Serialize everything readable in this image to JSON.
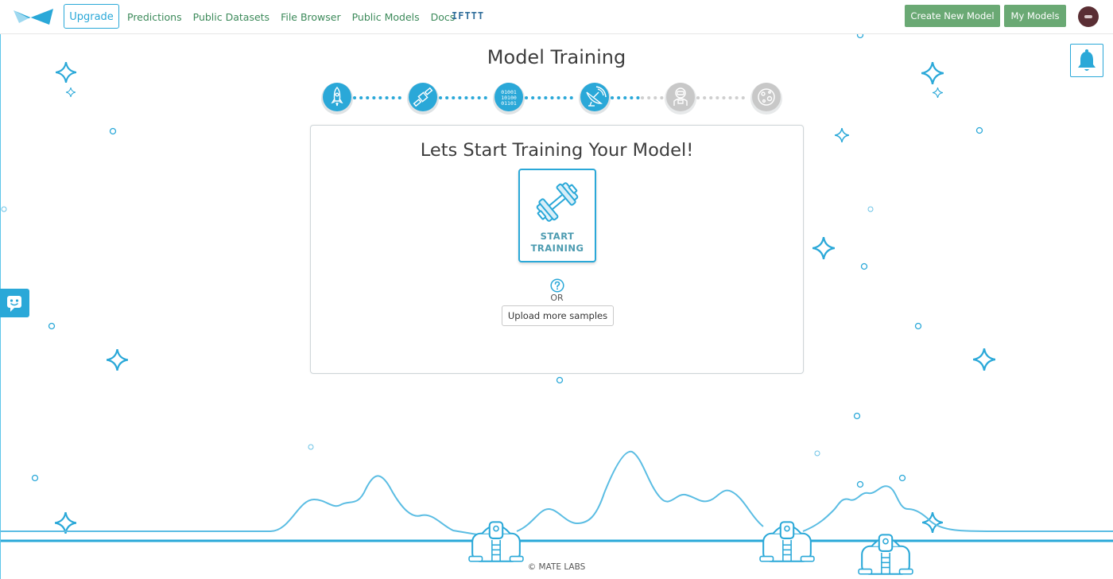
{
  "nav": {
    "upgrade_label": "Upgrade",
    "links": [
      "Predictions",
      "Public Datasets",
      "File Browser",
      "Public Models",
      "Docs"
    ],
    "ifttt_label": "IFTTT",
    "create_label": "Create New Model",
    "my_models_label": "My Models"
  },
  "page": {
    "title": "Model Training"
  },
  "progress": {
    "steps": [
      {
        "icon": "rocket-icon",
        "state": "complete"
      },
      {
        "icon": "satellite-icon",
        "state": "complete"
      },
      {
        "icon": "binary-data-icon",
        "state": "complete"
      },
      {
        "icon": "satellite-dish-icon",
        "state": "current"
      },
      {
        "icon": "astronaut-icon",
        "state": "pending"
      },
      {
        "icon": "moon-icon",
        "state": "pending"
      }
    ]
  },
  "card": {
    "title": "Lets Start Training Your Model!",
    "start_label_line1": "START",
    "start_label_line2": "TRAINING",
    "or_label": "OR",
    "upload_label": "Upload more samples"
  },
  "footer": {
    "copyright": "© MATE LABS"
  },
  "colors": {
    "accent": "#2aa8d8",
    "nav_link": "#3c8a5a",
    "green_button": "#6aa974",
    "pending_step": "#c8c8c8"
  }
}
